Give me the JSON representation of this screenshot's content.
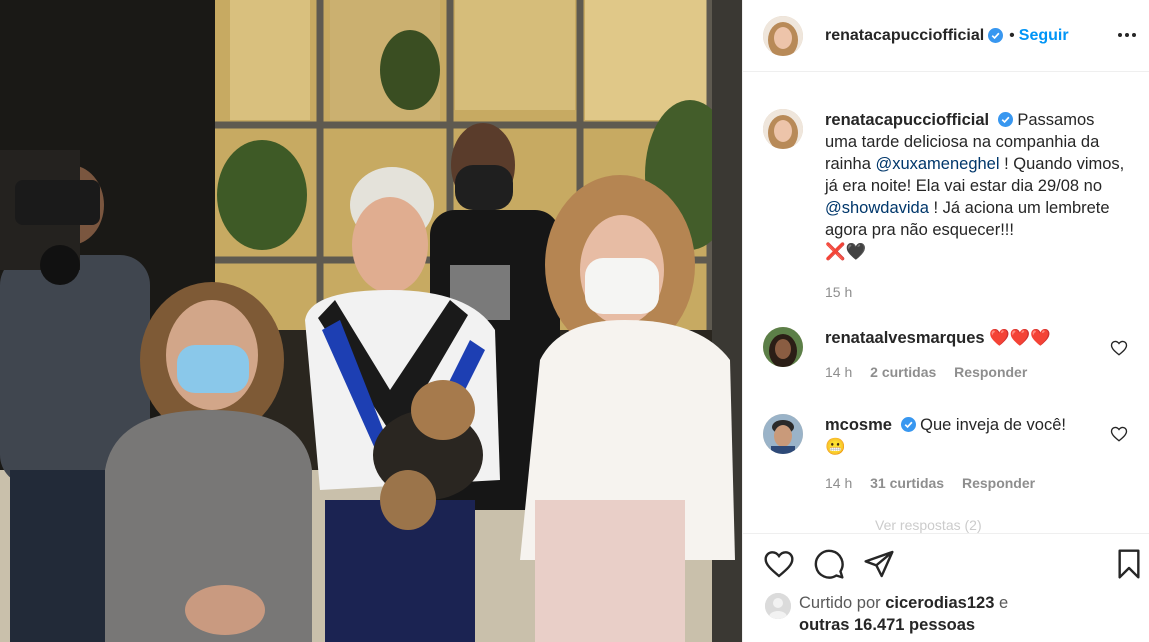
{
  "post": {
    "username": "renatacapucciofficial",
    "follow_label": "Seguir",
    "separator": "•"
  },
  "caption": {
    "username": "renatacapucciofficial",
    "text_1": "Passamos uma tarde deliciosa na companhia da rainha ",
    "mention_1": "@xuxameneghel",
    "text_2": " ! Quando vimos, já era noite! Ela vai estar dia 29/08 no ",
    "mention_2": "@showdavida",
    "text_3": " ! Já aciona um lembrete agora pra não esquecer!!!",
    "emoji": "❌🖤",
    "time": "15 h"
  },
  "comments": [
    {
      "username": "renataalvesmarques",
      "text": "❤️❤️❤️",
      "time": "14 h",
      "likes": "2 curtidas",
      "reply": "Responder"
    },
    {
      "username": "mcosme",
      "text": "Que inveja de você!",
      "emoji": "😬",
      "time": "14 h",
      "likes": "31 curtidas",
      "reply": "Responder"
    }
  ],
  "more_replies": "Ver respostas (2)",
  "liked_by": {
    "prefix": "Curtido por ",
    "user": "cicerodias123",
    "mid": " e",
    "others": "outras 16.471 pessoas"
  },
  "icons": {
    "like": "heart-icon",
    "comment": "comment-icon",
    "share": "paper-plane-icon",
    "save": "bookmark-icon",
    "more": "ellipsis-icon",
    "verified": "verified-badge-icon"
  },
  "colors": {
    "link_blue": "#0095f6",
    "mention": "#00376b",
    "verified": "#3897f0",
    "muted": "#8e8e8e"
  }
}
